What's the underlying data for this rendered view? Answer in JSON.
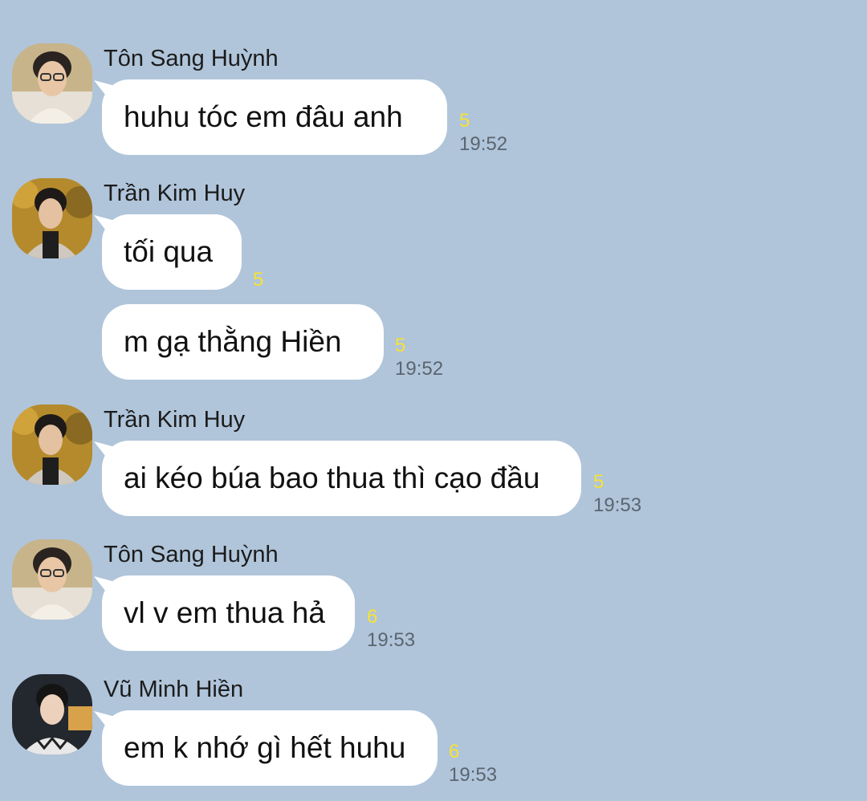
{
  "messages": [
    {
      "sender": "Tôn Sang Huỳnh",
      "avatar": "avatar-ton-sang-huynh",
      "text": "huhu tóc em đâu anh",
      "unread": "5",
      "time": "19:52"
    },
    {
      "sender": "Trần Kim Huy",
      "avatar": "avatar-tran-kim-huy",
      "text": "tối qua",
      "unread": "5",
      "time": ""
    },
    {
      "sender": "",
      "avatar": "",
      "text": "m gạ thằng Hiền",
      "unread": "5",
      "time": "19:52"
    },
    {
      "sender": "Trần Kim Huy",
      "avatar": "avatar-tran-kim-huy",
      "text": "ai kéo búa bao thua thì cạo đầu",
      "unread": "5",
      "time": "19:53"
    },
    {
      "sender": "Tôn Sang Huỳnh",
      "avatar": "avatar-ton-sang-huynh",
      "text": "vl v em thua hả",
      "unread": "6",
      "time": "19:53"
    },
    {
      "sender": "Vũ Minh Hiền",
      "avatar": "avatar-vu-minh-hien",
      "text": "em k nhớ gì hết huhu",
      "unread": "6",
      "time": "19:53"
    }
  ],
  "colors": {
    "background": "#b0c5da",
    "bubble": "#ffffff",
    "unread": "#f5e234",
    "time": "#5b6570"
  }
}
